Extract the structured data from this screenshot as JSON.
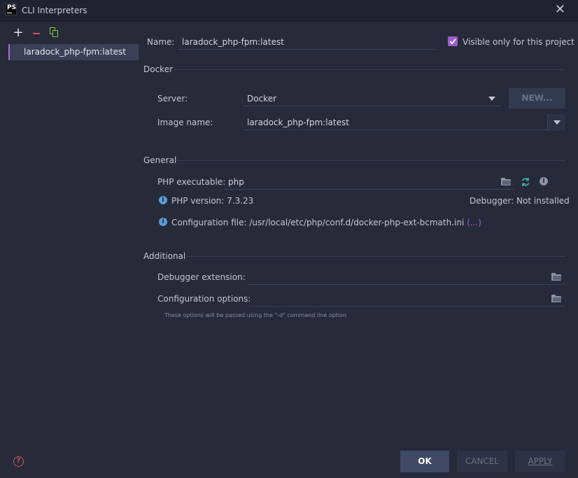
{
  "window": {
    "title": "CLI Interpreters",
    "app_icon_text": "PS"
  },
  "sidebar": {
    "items": [
      {
        "label": "laradock_php-fpm:latest",
        "selected": true
      }
    ]
  },
  "toolbar": {
    "add_symbol": "+",
    "icons": [
      "plus-icon",
      "minus-icon",
      "copy-icon"
    ]
  },
  "form": {
    "name_label": "Name:",
    "name_value": "laradock_php-fpm:latest",
    "visible_only_label": "Visible only for this project",
    "visible_only_checked": true
  },
  "docker": {
    "section_title": "Docker",
    "server_label": "Server:",
    "server_value": "Docker",
    "new_button": "NEW...",
    "image_label": "Image name:",
    "image_value": "laradock_php-fpm:latest"
  },
  "general": {
    "section_title": "General",
    "php_exec_label": "PHP executable:",
    "php_exec_value": "php",
    "php_version_text": "PHP version: 7.3.23",
    "debugger_text": "Debugger:  Not installed",
    "config_file_text": "Configuration file: /usr/local/etc/php/conf.d/docker-php-ext-bcmath.ini",
    "config_file_more": "(...)"
  },
  "additional": {
    "section_title": "Additional",
    "debugger_ext_label": "Debugger extension:",
    "debugger_ext_value": "",
    "config_options_label": "Configuration options:",
    "config_options_value": "",
    "hint": "These options will be passed using the \"-d\" command line option"
  },
  "footer": {
    "ok": "OK",
    "cancel": "CANCEL",
    "apply": "APPLY",
    "help_symbol": "?"
  },
  "colors": {
    "background": "#262a39",
    "accent": "#9b5ecf",
    "selection": "#3b4056",
    "ok_button": "#3f4a66",
    "remove_red": "#d2545c",
    "copy_green": "#8bc34a",
    "refresh_teal": "#3fb6b6",
    "info_blue": "#5b9ad8"
  }
}
